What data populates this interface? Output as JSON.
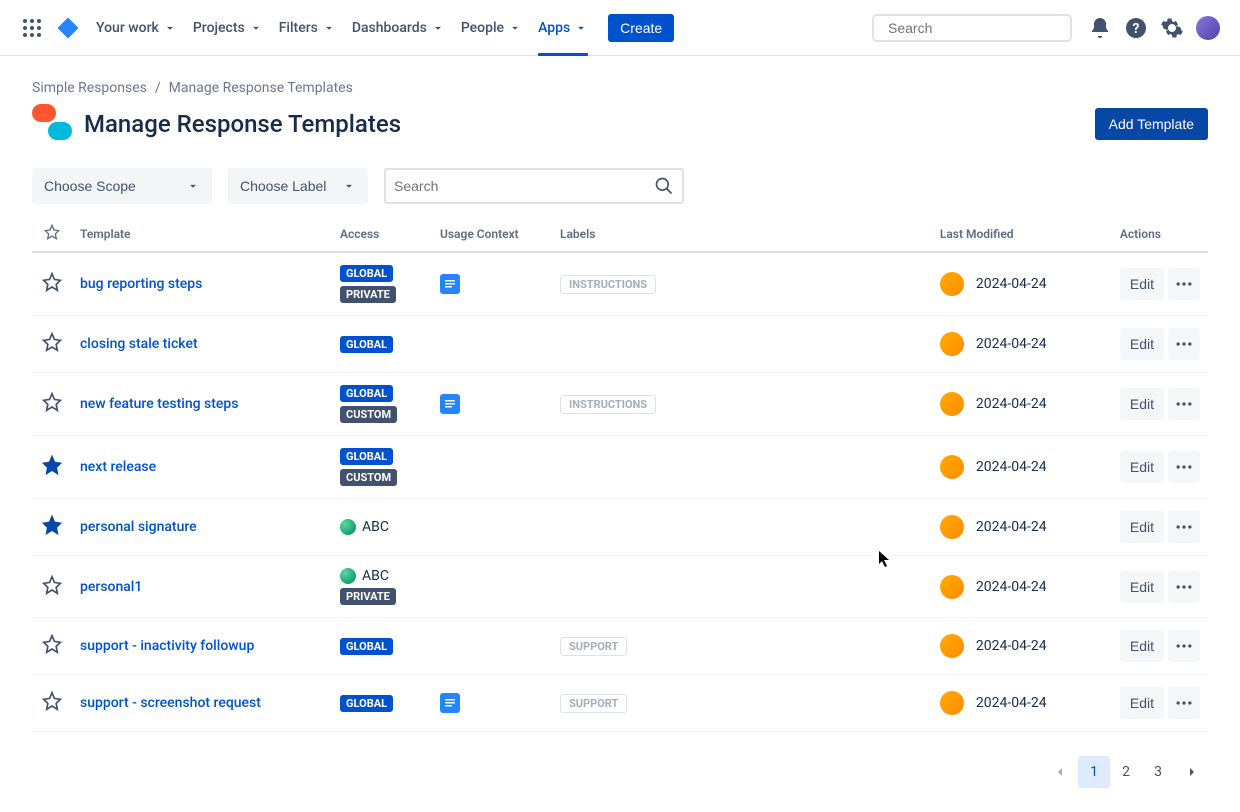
{
  "nav": {
    "items": [
      "Your work",
      "Projects",
      "Filters",
      "Dashboards",
      "People",
      "Apps"
    ],
    "active_index": 5,
    "create_label": "Create",
    "search_placeholder": "Search"
  },
  "breadcrumb": {
    "app": "Simple Responses",
    "page": "Manage Response Templates"
  },
  "title": "Manage Response Templates",
  "add_button": "Add Template",
  "filters": {
    "scope_label": "Choose Scope",
    "label_label": "Choose Label",
    "search_placeholder": "Search"
  },
  "columns": {
    "star": "",
    "template": "Template",
    "access": "Access",
    "usage": "Usage Context",
    "labels": "Labels",
    "modified": "Last Modified",
    "actions": "Actions"
  },
  "edit_label": "Edit",
  "rows": [
    {
      "starred": false,
      "name": "bug reporting steps",
      "access": [
        "GLOBAL",
        "PRIVATE"
      ],
      "usage": true,
      "labels": [
        "INSTRUCTIONS"
      ],
      "modified": "2024-04-24"
    },
    {
      "starred": false,
      "name": "closing stale ticket",
      "access": [
        "GLOBAL"
      ],
      "usage": false,
      "labels": [],
      "modified": "2024-04-24"
    },
    {
      "starred": false,
      "name": "new feature testing steps",
      "access": [
        "GLOBAL",
        "CUSTOM"
      ],
      "usage": true,
      "labels": [
        "INSTRUCTIONS"
      ],
      "modified": "2024-04-24"
    },
    {
      "starred": true,
      "name": "next release",
      "access": [
        "GLOBAL",
        "CUSTOM"
      ],
      "usage": false,
      "labels": [],
      "modified": "2024-04-24"
    },
    {
      "starred": true,
      "name": "personal signature",
      "access_project": "ABC",
      "access": [],
      "usage": false,
      "labels": [],
      "modified": "2024-04-24"
    },
    {
      "starred": false,
      "name": "personal1",
      "access_project": "ABC",
      "access": [
        "PRIVATE"
      ],
      "usage": false,
      "labels": [],
      "modified": "2024-04-24"
    },
    {
      "starred": false,
      "name": "support - inactivity followup",
      "access": [
        "GLOBAL"
      ],
      "usage": false,
      "labels": [
        "SUPPORT"
      ],
      "modified": "2024-04-24"
    },
    {
      "starred": false,
      "name": "support - screenshot request",
      "access": [
        "GLOBAL"
      ],
      "usage": true,
      "labels": [
        "SUPPORT"
      ],
      "modified": "2024-04-24"
    }
  ],
  "pagination": {
    "current": 1,
    "pages": [
      1,
      2,
      3
    ]
  }
}
